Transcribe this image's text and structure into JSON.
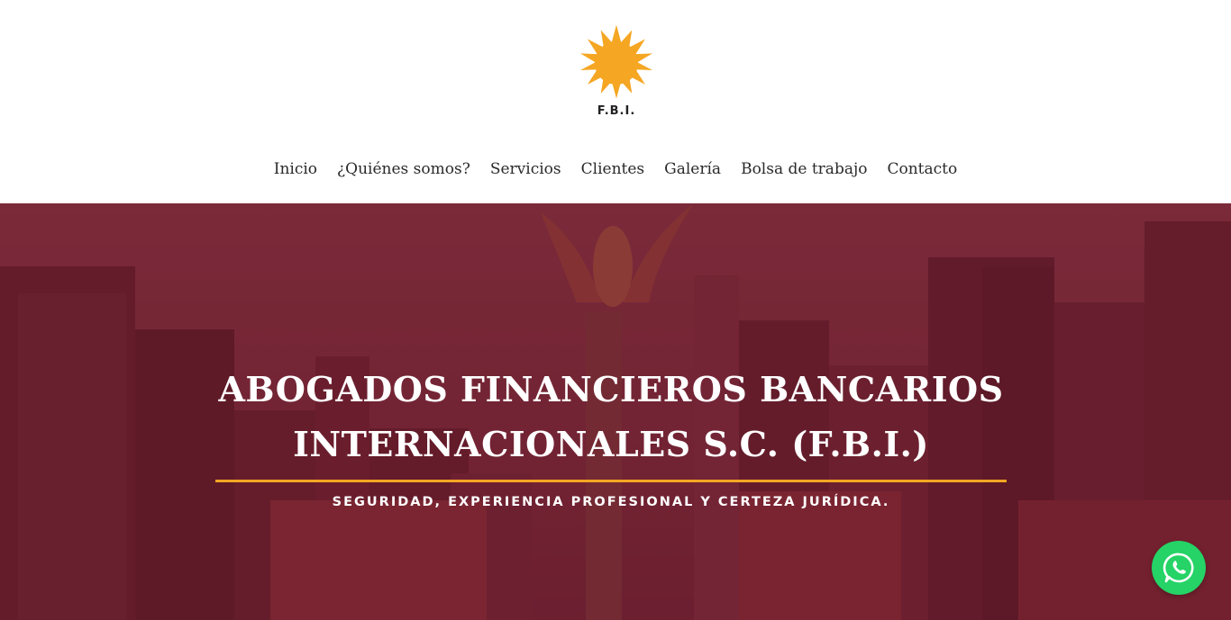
{
  "brand": {
    "logo_text": "F.B.I.",
    "logo_icon": "sun-icon",
    "sun_color": "#f5a623"
  },
  "nav": {
    "items": [
      {
        "label": "Inicio"
      },
      {
        "label": "¿Quiénes somos?"
      },
      {
        "label": "Servicios"
      },
      {
        "label": "Clientes"
      },
      {
        "label": "Galería"
      },
      {
        "label": "Bolsa de trabajo"
      },
      {
        "label": "Contacto"
      }
    ]
  },
  "hero": {
    "title_line1": "ABOGADOS FINANCIEROS BANCARIOS",
    "title_line2": "INTERNACIONALES S.C. (F.B.I.)",
    "subtitle": "SEGURIDAD, EXPERIENCIA PROFESIONAL Y CERTEZA JURÍDICA.",
    "overlay_color": "#6e1e2d",
    "accent_color": "#f5a623"
  },
  "floating": {
    "whatsapp_icon": "whatsapp-icon",
    "whatsapp_color": "#25d366"
  }
}
